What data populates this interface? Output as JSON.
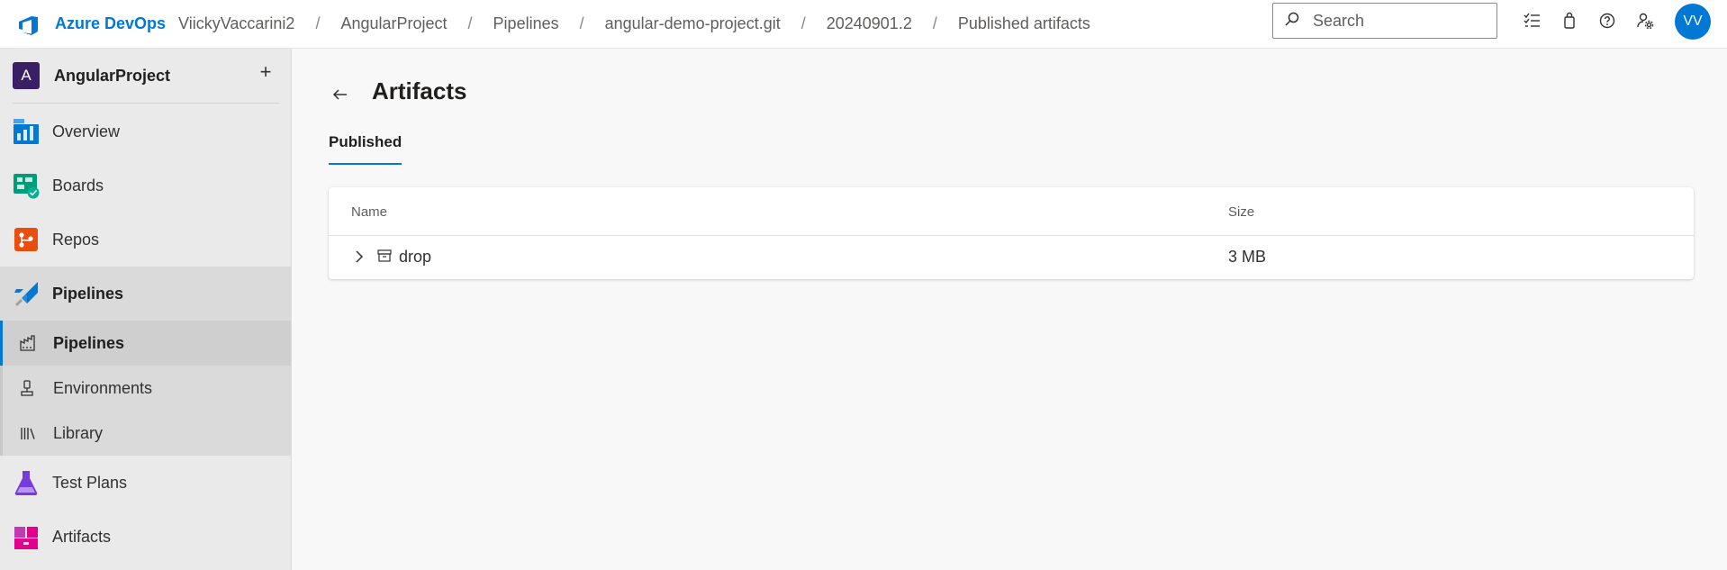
{
  "header": {
    "brand": "Azure DevOps",
    "breadcrumbs": [
      "ViickyVaccarini2",
      "AngularProject",
      "Pipelines",
      "angular-demo-project.git",
      "20240901.2",
      "Published artifacts"
    ],
    "search_placeholder": "Search",
    "icons": [
      "task-list-icon",
      "shopping-bag-icon",
      "help-icon",
      "user-settings-icon"
    ],
    "avatar_initials": "VV"
  },
  "sidebar": {
    "project_initial": "A",
    "project_name": "AngularProject",
    "add_label": "+",
    "items": [
      {
        "label": "Overview",
        "icon": "overview-icon"
      },
      {
        "label": "Boards",
        "icon": "boards-icon"
      },
      {
        "label": "Repos",
        "icon": "repos-icon"
      },
      {
        "label": "Pipelines",
        "icon": "pipelines-icon",
        "expanded": true,
        "children": [
          {
            "label": "Pipelines",
            "icon": "pipelines-sub-icon",
            "active": true
          },
          {
            "label": "Environments",
            "icon": "environments-icon"
          },
          {
            "label": "Library",
            "icon": "library-icon"
          }
        ]
      },
      {
        "label": "Test Plans",
        "icon": "test-plans-icon"
      },
      {
        "label": "Artifacts",
        "icon": "artifacts-icon"
      }
    ]
  },
  "main": {
    "title": "Artifacts",
    "tab": "Published",
    "table": {
      "columns": [
        "Name",
        "Size"
      ],
      "rows": [
        {
          "name": "drop",
          "size": "3 MB"
        }
      ]
    }
  },
  "colors": {
    "accent": "#0078d4",
    "project_badge": "#3a1f67"
  }
}
